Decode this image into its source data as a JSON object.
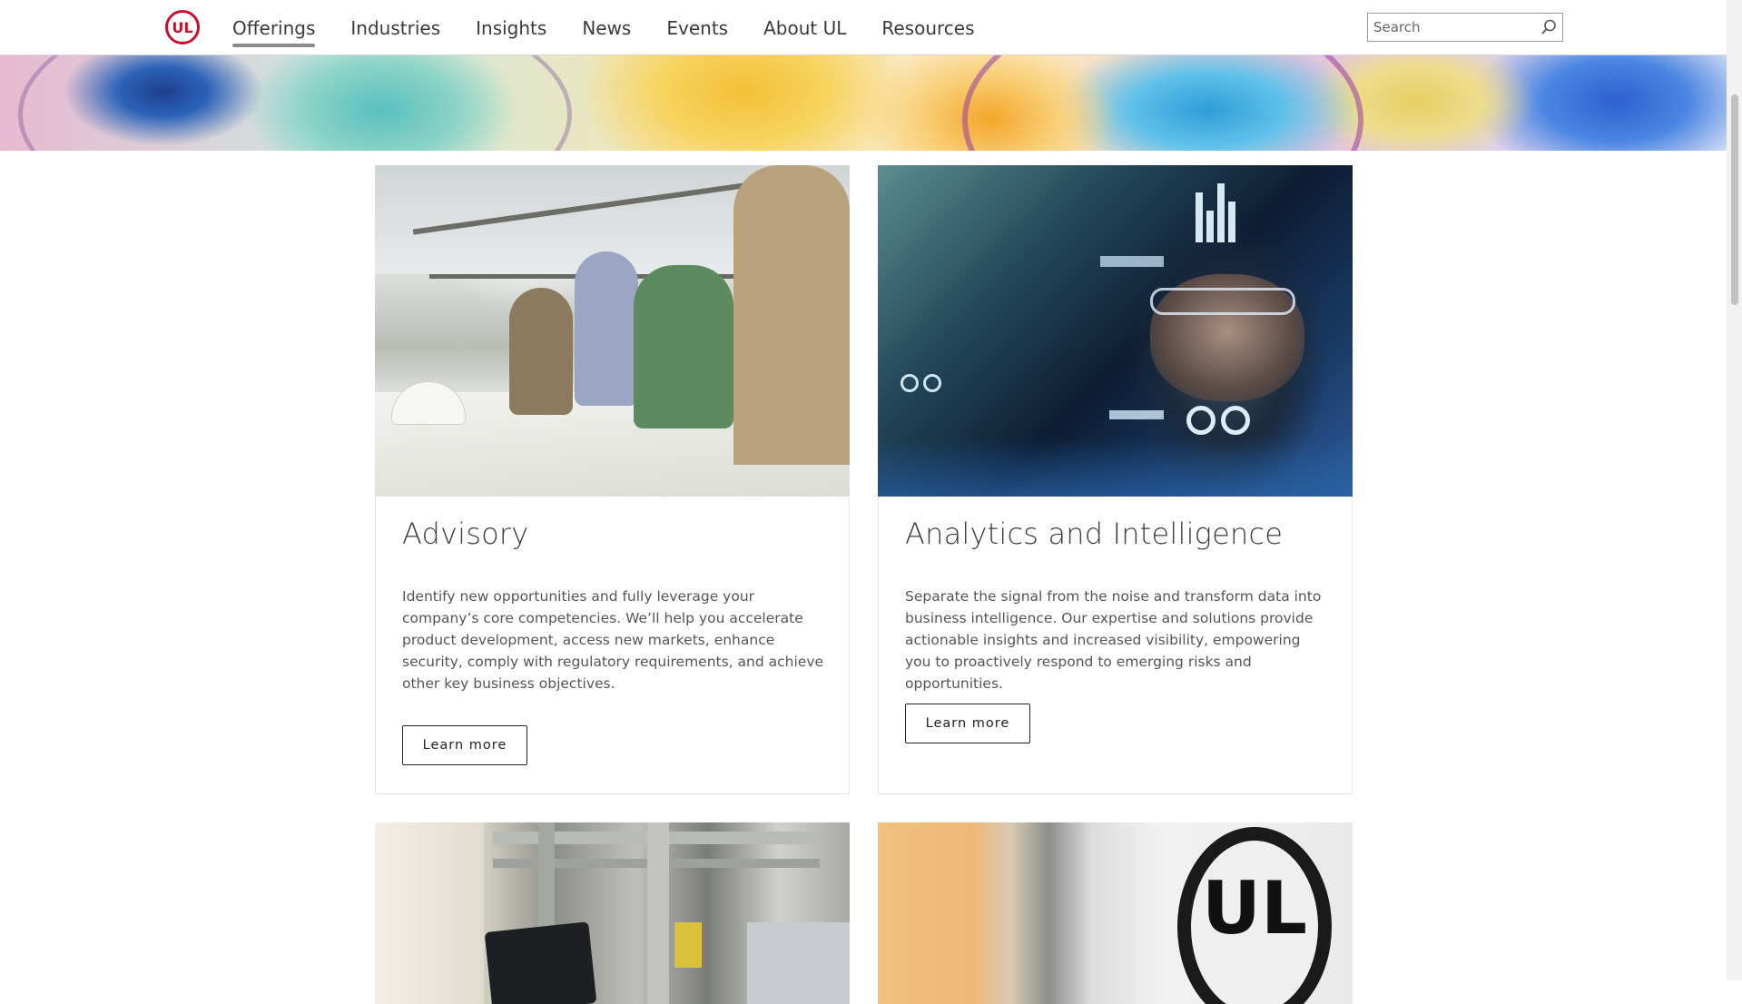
{
  "header": {
    "logo_text": "UL",
    "nav": [
      {
        "label": "Offerings",
        "active": true
      },
      {
        "label": "Industries",
        "active": false
      },
      {
        "label": "Insights",
        "active": false
      },
      {
        "label": "News",
        "active": false
      },
      {
        "label": "Events",
        "active": false
      },
      {
        "label": "About UL",
        "active": false
      },
      {
        "label": "Resources",
        "active": false
      }
    ],
    "search": {
      "placeholder": "Search",
      "value": "",
      "icon": "search-icon"
    }
  },
  "colors": {
    "brand_red": "#c8102e",
    "text": "#333333",
    "nav_underline": "#8a8a8a"
  },
  "cards": [
    {
      "title": "Advisory",
      "description": "Identify new opportunities and fully leverage your company’s core competencies. We’ll help you accelerate product development, access new markets, enhance security, comply with regulatory requirements, and achieve other key business objectives.",
      "button": "Learn more",
      "image": "team-reviewing-blueprints-photo"
    },
    {
      "title": "Analytics and Intelligence",
      "description": "Separate the signal from the noise and transform data into business intelligence. Our expertise and solutions provide actionable insights and increased visibility, empowering you to proactively respond to emerging risks and opportunities.",
      "button": "Learn more",
      "image": "woman-with-data-overlay-photo"
    },
    {
      "image": "industrial-tablet-photo"
    },
    {
      "image": "ul-mark-photo",
      "mark_text": "UL"
    }
  ]
}
